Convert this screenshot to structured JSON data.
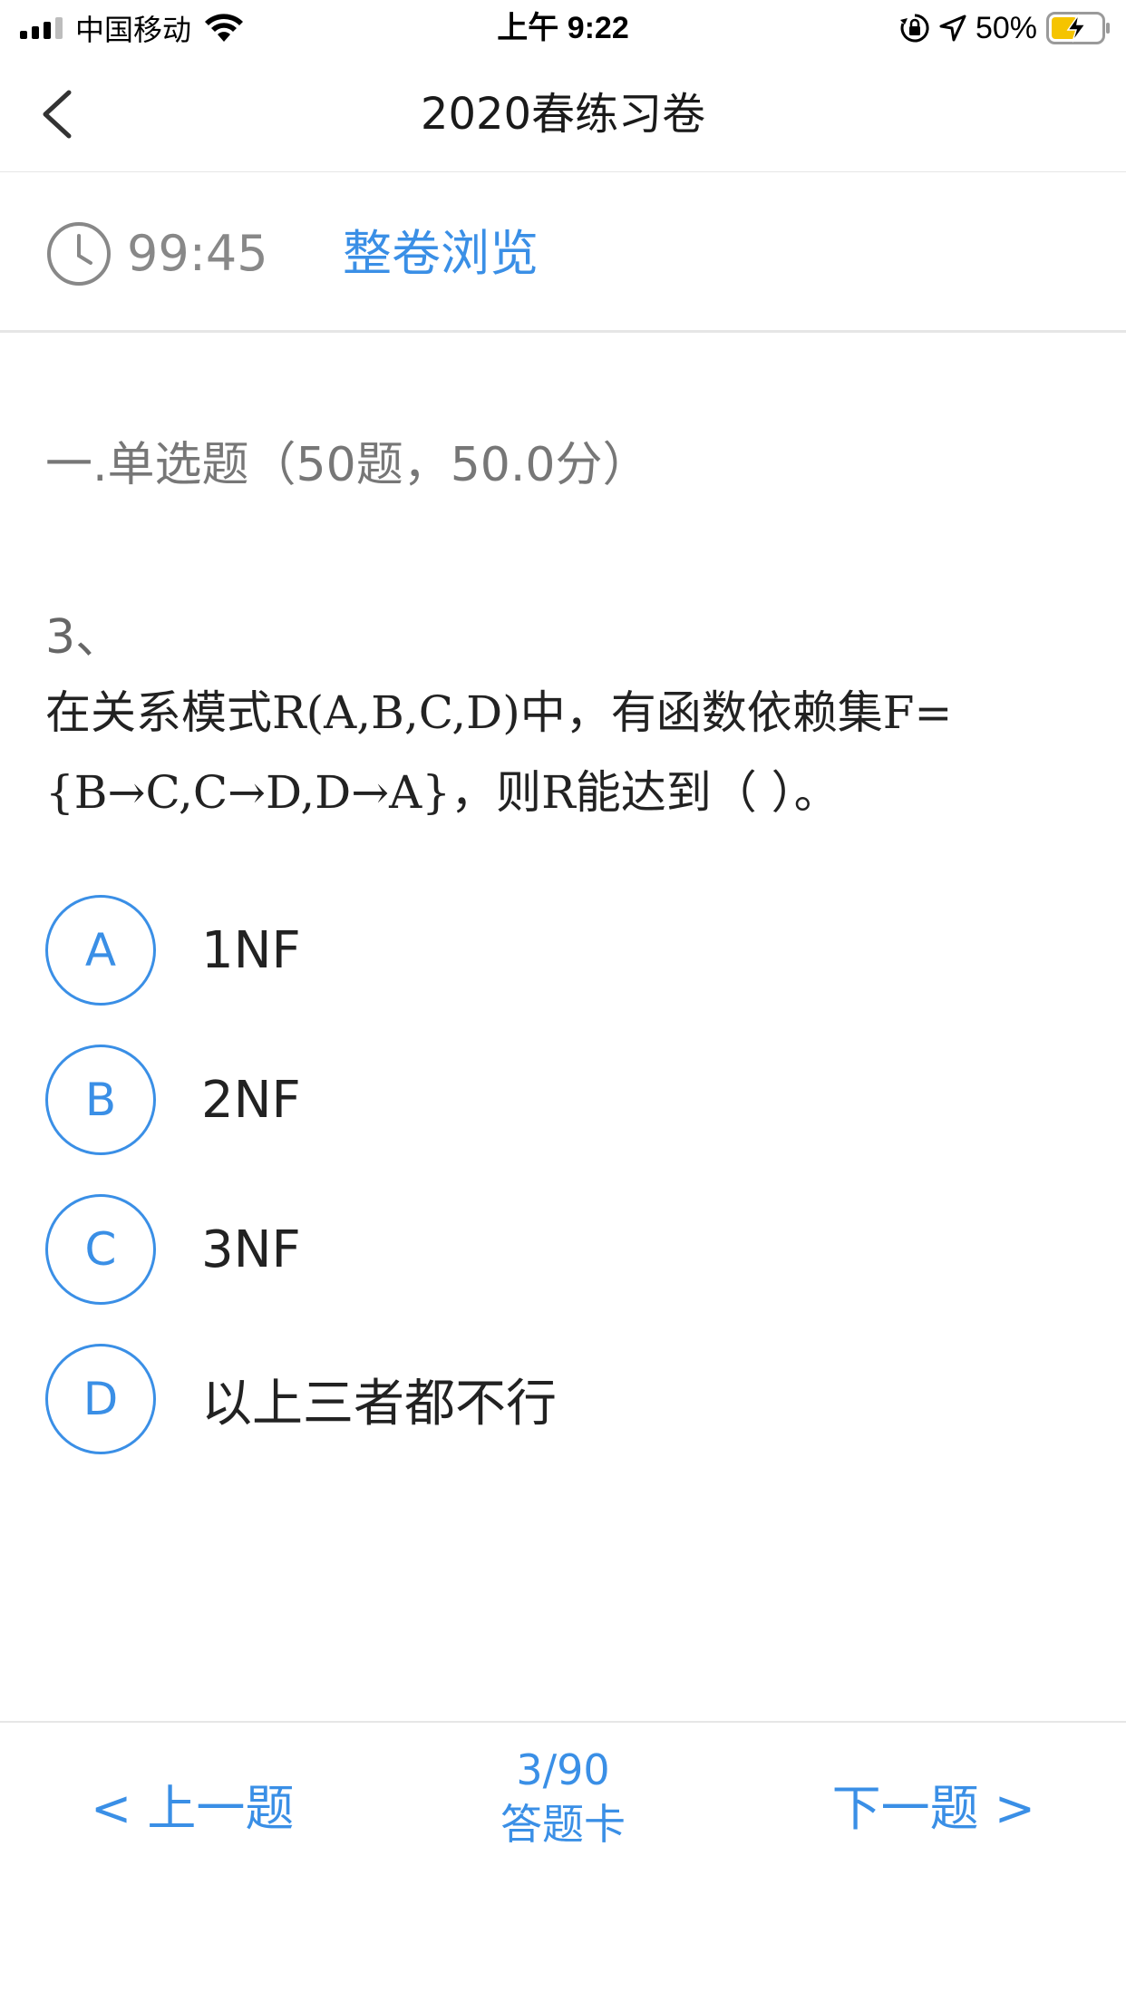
{
  "status_bar": {
    "carrier": "中国移动",
    "time": "上午 9:22",
    "battery_percent": "50%",
    "signal_icon": "cellular-signal-icon",
    "wifi_icon": "wifi-icon",
    "rotation_lock_icon": "rotation-lock-icon",
    "location_icon": "location-arrow-icon",
    "battery_icon": "battery-charging-icon"
  },
  "nav": {
    "title": "2020春练习卷",
    "back_icon": "chevron-left-icon"
  },
  "timer": {
    "icon": "clock-icon",
    "value": "99:45",
    "browse_label": "整卷浏览"
  },
  "section": {
    "title": "一.单选题（50题，50.0分）"
  },
  "question": {
    "number": "3、",
    "text": " 在关系模式R(A,B,C,D)中，有函数依赖集F=\n{B→C,C→D,D→A}，则R能达到（  ）。"
  },
  "options": [
    {
      "letter": "A",
      "text": "1NF"
    },
    {
      "letter": "B",
      "text": "2NF"
    },
    {
      "letter": "C",
      "text": "3NF"
    },
    {
      "letter": "D",
      "text": "以上三者都不行"
    }
  ],
  "footer": {
    "prev_label": "< 上一题",
    "progress": "3/90",
    "card_label": "答题卡",
    "next_label": "下一题 >"
  },
  "colors": {
    "accent": "#3a8fe6",
    "muted_text": "#888888",
    "divider": "#e6e6e6"
  }
}
